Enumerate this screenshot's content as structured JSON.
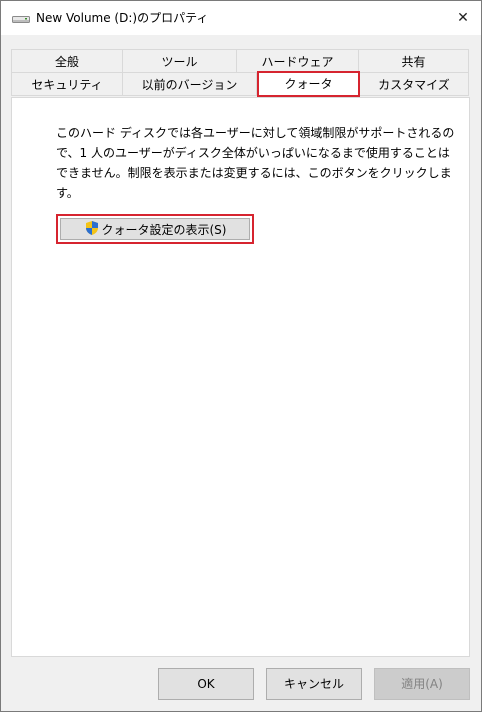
{
  "window": {
    "title": "New Volume (D:)のプロパティ",
    "close_glyph": "✕",
    "icon": "drive-icon"
  },
  "tabs": {
    "row1": [
      "全般",
      "ツール",
      "ハードウェア",
      "共有"
    ],
    "row2": [
      "セキュリティ",
      "以前のバージョン",
      "クォータ",
      "カスタマイズ"
    ],
    "active": "クォータ"
  },
  "content": {
    "description_lines": [
      "このハード ディスクでは各ユーザーに対して領域制限がサポートされるの",
      "で、1 人のユーザーがディスク全体がいっぱいになるまで使用することは",
      "できません。制限を表示または変更するには、このボタンをクリックしま",
      "す。"
    ],
    "show_quota_button": "クォータ設定の表示(S)",
    "shield_icon": "uac-shield-icon"
  },
  "buttons": {
    "ok": "OK",
    "cancel": "キャンセル",
    "apply": "適用(A)"
  },
  "colors": {
    "highlight": "#d6242f",
    "panel_bg": "#ffffff",
    "dialog_bg": "#f0f0f0"
  }
}
